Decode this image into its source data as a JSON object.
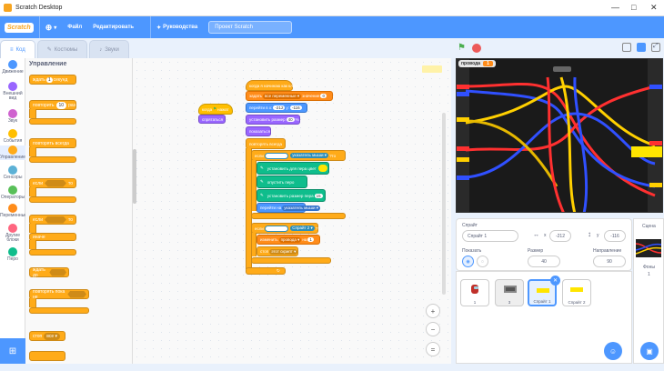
{
  "window": {
    "title": "Scratch Desktop",
    "controls": [
      "—",
      "□",
      "✕"
    ]
  },
  "menu": {
    "logo": "Scratch",
    "globe": "⊕",
    "file": "Файл",
    "edit": "Редактировать",
    "tutorials": "Руководства",
    "project_title": "Проект Scratch"
  },
  "tabs": [
    {
      "label": "Код"
    },
    {
      "label": "Костюмы"
    },
    {
      "label": "Звуки"
    }
  ],
  "categories": [
    {
      "label": "Движение",
      "color": "#4c97ff"
    },
    {
      "label": "Внешний вид",
      "color": "#9966ff"
    },
    {
      "label": "Звук",
      "color": "#cf63cf"
    },
    {
      "label": "События",
      "color": "#ffbf00"
    },
    {
      "label": "Управление",
      "color": "#ffab19"
    },
    {
      "label": "Сенсоры",
      "color": "#5cb1d6"
    },
    {
      "label": "Операторы",
      "color": "#59c059"
    },
    {
      "label": "Переменные",
      "color": "#ff8c1a"
    },
    {
      "label": "Другие блоки",
      "color": "#ff6680"
    },
    {
      "label": "Перо",
      "color": "#0fbd8c"
    }
  ],
  "palette": {
    "heading": "Управление",
    "wait": "ждать",
    "wait_val": "1",
    "seconds": "секунд",
    "repeat": "повторить",
    "repeat_val": "10",
    "times": "раз",
    "forever": "повторять всегда",
    "if": "если",
    "then": "то",
    "else": "иначе",
    "wait_until": "ждать до",
    "repeat_until": "повторять пока не",
    "stop": "стоп",
    "stop_val": "все ▾"
  },
  "scripts": {
    "hat1": "когда",
    "hat1_b": "нажат",
    "hide": "спрятаться",
    "s1": "когда я начинаю как клон",
    "s2a": "задать",
    "s2b": "все переменные ▾",
    "s2c": "значение",
    "s2v": "0",
    "s3a": "перейти в x:",
    "s3x": "-212",
    "s3b": "y:",
    "s3y": "-116",
    "s4a": "установить размер",
    "s4v": "40",
    "s4b": "%",
    "s5": "показаться",
    "s6": "повторять всегда",
    "s7a": "если",
    "s7b": "касается",
    "s7c": "указатель мыши ▾",
    "s7d": "?",
    "s7e": "то",
    "p1": "установить для пера цвет",
    "p2": "опустить перо",
    "p3a": "установить размер пера",
    "p3v": "15",
    "s8a": "перейти на",
    "s8b": "указатель мыши ▾",
    "s9a": "если",
    "s9b": "касается",
    "s9c": "Спрайт 2 ▾",
    "s9d": "?",
    "s9e": "то",
    "s10a": "изменить",
    "s10b": "провода ▾",
    "s10c": "на",
    "s10v": "1",
    "s11a": "стоп",
    "s11b": "этот скрипт ▾"
  },
  "zoom": [
    "+",
    "−",
    "="
  ],
  "monitor": {
    "name": "провода",
    "value": "1"
  },
  "sprite_info": {
    "label": "Спрайт",
    "name": "Спрайт 1",
    "x_label": "x",
    "x": "-212",
    "y_label": "y",
    "y": "-116",
    "show_label": "Показать",
    "size_label": "Размер",
    "size": "40",
    "dir_label": "Направление",
    "dir": "90"
  },
  "sprites": [
    {
      "name": "1"
    },
    {
      "name": "3"
    },
    {
      "name": "Спрайт 1"
    },
    {
      "name": "Спрайт 2"
    }
  ],
  "stage_pane": {
    "label": "Сцена",
    "backdrops_label": "Фоны",
    "backdrops": "1"
  }
}
